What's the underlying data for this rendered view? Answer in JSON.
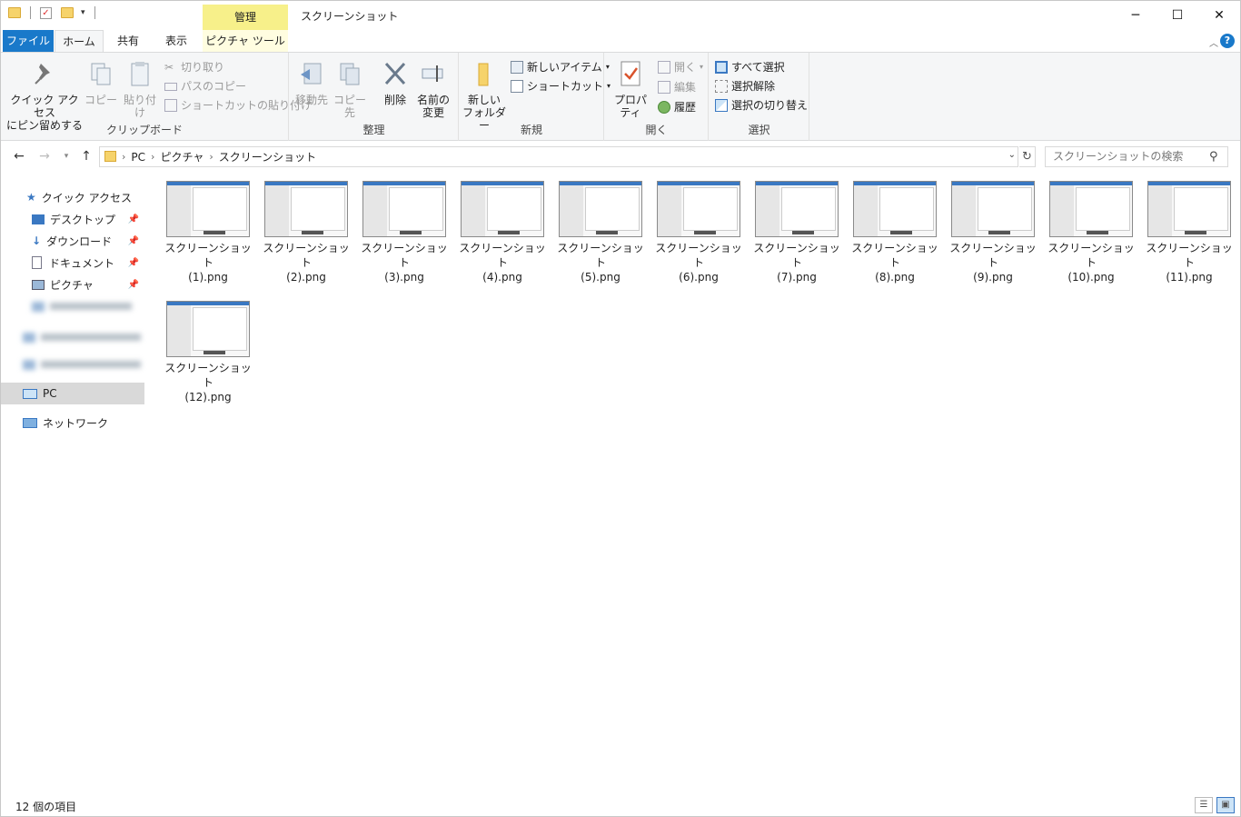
{
  "window": {
    "title": "スクリーンショット",
    "contextual_tab_group": "管理",
    "controls": {
      "minimize": "─",
      "maximize": "☐",
      "close": "✕"
    }
  },
  "tabs": [
    "ファイル",
    "ホーム",
    "共有",
    "表示",
    "ピクチャ ツール"
  ],
  "ribbon": {
    "clipboard": {
      "label": "クリップボード",
      "pin_line1": "クイック アクセス",
      "pin_line2": "にピン留めする",
      "copy": "コピー",
      "paste": "貼り付け",
      "cut": "切り取り",
      "copy_path": "パスのコピー",
      "paste_shortcut": "ショートカットの貼り付け"
    },
    "organize": {
      "label": "整理",
      "move_to": "移動先",
      "copy_to": "コピー先",
      "delete": "削除",
      "rename_line1": "名前の",
      "rename_line2": "変更"
    },
    "new": {
      "label": "新規",
      "new_folder_line1": "新しい",
      "new_folder_line2": "フォルダー",
      "new_item": "新しいアイテム",
      "shortcut": "ショートカット"
    },
    "open": {
      "label": "開く",
      "properties": "プロパティ",
      "open": "開く",
      "edit": "編集",
      "history": "履歴"
    },
    "select": {
      "label": "選択",
      "select_all": "すべて選択",
      "select_none": "選択解除",
      "invert": "選択の切り替え"
    }
  },
  "address": {
    "crumbs": [
      "PC",
      "ピクチャ",
      "スクリーンショット"
    ],
    "search_placeholder": "スクリーンショットの検索"
  },
  "sidebar": {
    "quick_access": "クイック アクセス",
    "items": [
      {
        "label": "デスクトップ"
      },
      {
        "label": "ダウンロード"
      },
      {
        "label": "ドキュメント"
      },
      {
        "label": "ピクチャ"
      }
    ],
    "pc": "PC",
    "network": "ネットワーク"
  },
  "files": [
    {
      "line1": "スクリーンショット",
      "line2": "(1).png"
    },
    {
      "line1": "スクリーンショット",
      "line2": "(2).png"
    },
    {
      "line1": "スクリーンショット",
      "line2": "(3).png"
    },
    {
      "line1": "スクリーンショット",
      "line2": "(4).png"
    },
    {
      "line1": "スクリーンショット",
      "line2": "(5).png"
    },
    {
      "line1": "スクリーンショット",
      "line2": "(6).png"
    },
    {
      "line1": "スクリーンショット",
      "line2": "(7).png"
    },
    {
      "line1": "スクリーンショット",
      "line2": "(8).png"
    },
    {
      "line1": "スクリーンショット",
      "line2": "(9).png"
    },
    {
      "line1": "スクリーンショット",
      "line2": "(10).png"
    },
    {
      "line1": "スクリーンショット",
      "line2": "(11).png"
    },
    {
      "line1": "スクリーンショット",
      "line2": "(12).png"
    }
  ],
  "status": {
    "item_count": "12 個の項目"
  },
  "colors": {
    "accent": "#1979ca",
    "contextual": "#f7f08a",
    "selected": "#d9d9d9"
  }
}
